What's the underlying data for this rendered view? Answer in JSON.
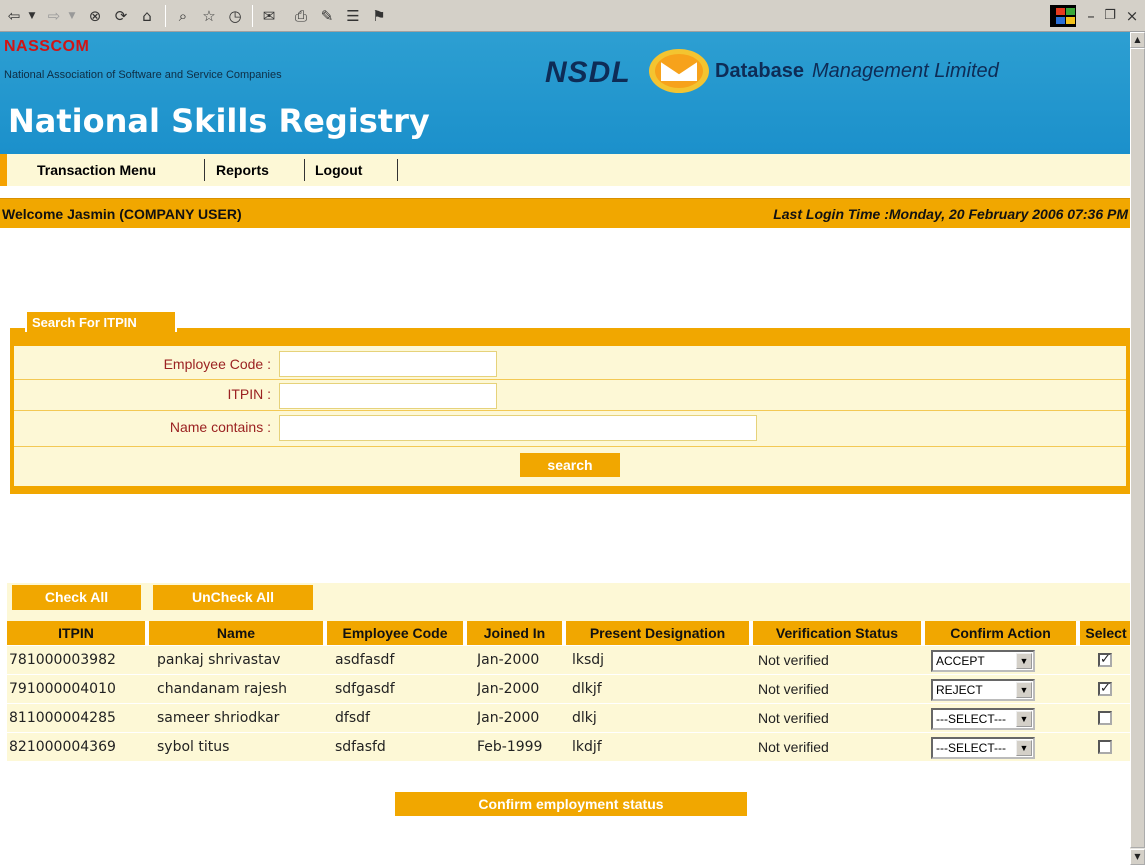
{
  "browser_toolbar": {
    "icons": [
      "back-icon",
      "dropdown-arrow-icon",
      "forward-icon",
      "dropdown-arrow-icon",
      "stop-icon",
      "refresh-icon",
      "home-icon",
      "search-icon",
      "favorites-icon",
      "history-icon",
      "mail-icon",
      "print-icon",
      "edit-icon",
      "discuss-icon",
      "messenger-icon"
    ],
    "window_controls": [
      "minimize-icon",
      "restore-icon",
      "close-icon"
    ]
  },
  "header": {
    "org_name": "NASSCOM",
    "org_full_name": "National Association of Software and Service Companies",
    "nsdl": "NSDL",
    "db_word": "Database",
    "mgmt_word": "Management Limited",
    "title": "National Skills Registry",
    "colors": {
      "banner": "#1b90cb",
      "accent": "#f1a700",
      "panel": "#fdf8d6"
    }
  },
  "nav": {
    "items": [
      {
        "label": "Transaction Menu"
      },
      {
        "label": "Reports"
      },
      {
        "label": "Logout"
      }
    ]
  },
  "welcome_bar": {
    "welcome": "Welcome Jasmin (COMPANY USER)",
    "last_login": "Last Login Time :Monday, 20 February 2006 07:36 PM"
  },
  "search": {
    "tab_label": "Search For ITPIN",
    "employee_code_label": "Employee Code :",
    "employee_code_value": "",
    "itpin_label": "ITPIN :",
    "itpin_value": "",
    "name_label": "Name contains :",
    "name_value": "",
    "search_button": "search"
  },
  "results": {
    "check_all": "Check All",
    "uncheck_all": "UnCheck All",
    "columns": [
      "ITPIN",
      "Name",
      "Employee Code",
      "Joined In",
      "Present Designation",
      "Verification Status",
      "Confirm Action",
      "Select"
    ],
    "rows": [
      {
        "itpin": "781000003982",
        "name": "pankaj shrivastav",
        "employee_code": "asdfasdf",
        "joined_in": "Jan-2000",
        "designation": "lksdj",
        "status": "Not verified",
        "action": "ACCEPT",
        "selected": true
      },
      {
        "itpin": "791000004010",
        "name": "chandanam rajesh",
        "employee_code": "sdfgasdf",
        "joined_in": "Jan-2000",
        "designation": "dlkjf",
        "status": "Not verified",
        "action": "REJECT",
        "selected": true
      },
      {
        "itpin": "811000004285",
        "name": "sameer shriodkar",
        "employee_code": "dfsdf",
        "joined_in": "Jan-2000",
        "designation": "dlkj",
        "status": "Not verified",
        "action": "---SELECT---",
        "selected": false
      },
      {
        "itpin": "821000004369",
        "name": "sybol titus",
        "employee_code": "sdfasfd",
        "joined_in": "Feb-1999",
        "designation": "lkdjf",
        "status": "Not verified",
        "action": "---SELECT---",
        "selected": false
      }
    ],
    "confirm_button": "Confirm employment status"
  }
}
